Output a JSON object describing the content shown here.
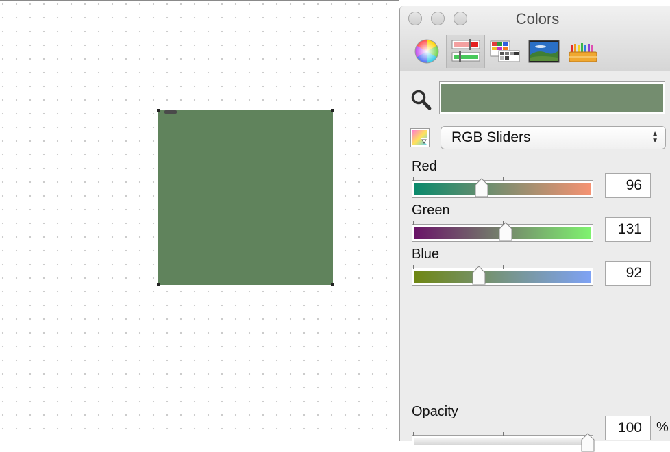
{
  "panel": {
    "title": "Colors",
    "tools": [
      {
        "name": "color-wheel-icon"
      },
      {
        "name": "color-sliders-icon",
        "selected": true
      },
      {
        "name": "color-palettes-icon"
      },
      {
        "name": "image-palettes-icon"
      },
      {
        "name": "crayons-icon"
      }
    ],
    "current_color": "#748d6f",
    "mode": "RGB Sliders",
    "sliders": [
      {
        "label": "Red",
        "value": "96",
        "fraction": 0.376,
        "from": "#0b8a6c",
        "to": "#f59272"
      },
      {
        "label": "Green",
        "value": "131",
        "fraction": 0.514,
        "from": "#6a1468",
        "to": "#7ff26f"
      },
      {
        "label": "Blue",
        "value": "92",
        "fraction": 0.361,
        "from": "#6f8714",
        "to": "#7ea2f4"
      }
    ],
    "opacity": {
      "label": "Opacity",
      "value": "100",
      "unit": "%",
      "fraction": 1.0
    }
  },
  "canvas": {
    "shape_color": "#60835c"
  }
}
